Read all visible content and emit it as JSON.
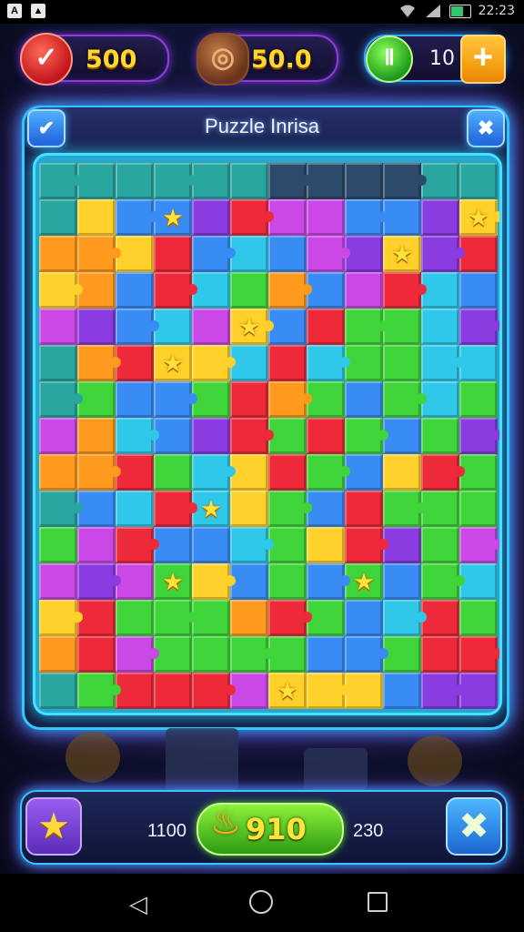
{
  "status_bar": {
    "time": "22:23",
    "icons": [
      "notification-icon",
      "notification-icon",
      "wifi-icon",
      "signal-icon",
      "battery-icon"
    ]
  },
  "resources": [
    {
      "name": "lives",
      "value": "500",
      "icon": "check-badge-icon"
    },
    {
      "name": "wood",
      "value": "50.0",
      "icon": "wood-log-icon"
    },
    {
      "name": "coins",
      "value": "10",
      "icon": "green-coin-icon",
      "action": "+"
    }
  ],
  "panel": {
    "title": "Puzzle Inrisa",
    "left_button": "✔",
    "right_button": "✖"
  },
  "board": {
    "rows": [
      "ttttttkkkktttt",
      "tybbprmmbbpy",
      "ooyrbcbmpyprp",
      "yobrcgobmrcb",
      "mpbcmybrggcp",
      "toryycrcggcc",
      "tgbbgrogbgcg",
      "mocbprgrgbgp",
      "oorgcyrgbyrg",
      "tbcrcygbrggg",
      "gmrbbcgyrpgm",
      "mpmgybgbgbgc",
      "yrgggorgbcrg",
      "ormggggbbgrr",
      "tgrrrmyyybpp"
    ],
    "pieces": [
      {
        "kind": "star",
        "row": 1,
        "col": 3
      },
      {
        "kind": "star",
        "row": 1,
        "col": 11
      },
      {
        "kind": "star",
        "row": 2,
        "col": 9
      },
      {
        "kind": "star",
        "row": 4,
        "col": 5
      },
      {
        "kind": "star",
        "row": 5,
        "col": 3
      },
      {
        "kind": "star",
        "row": 9,
        "col": 4
      },
      {
        "kind": "star",
        "row": 11,
        "col": 3
      },
      {
        "kind": "star",
        "row": 11,
        "col": 8
      },
      {
        "kind": "star",
        "row": 14,
        "col": 6
      }
    ]
  },
  "bottom_bar": {
    "left_value": "1100",
    "center_value": "910",
    "right_value": "230",
    "left_button_icon": "star-icon",
    "right_button_icon": "hammer-tool-icon",
    "center_icon": "flame-icon"
  },
  "colors": {
    "glow_cyan": "#2ccaff",
    "glow_purple": "#8c3dd8",
    "gold_text": "#ffd72e",
    "accent_green": "#3fd43a",
    "accent_orange": "#ff9a1e"
  }
}
